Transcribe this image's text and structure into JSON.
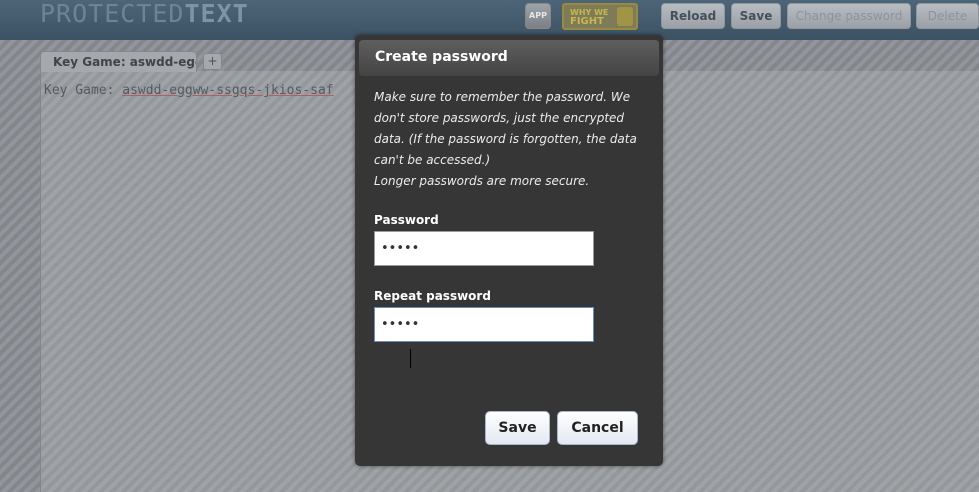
{
  "header": {
    "logo_light": "PROTECTED",
    "logo_bold": "TEXT",
    "app_label": "APP",
    "fight_line1": "WHY WE",
    "fight_line2": "FIGHT",
    "buttons": {
      "reload": "Reload",
      "save": "Save",
      "change_password": "Change password",
      "delete": "Delete"
    }
  },
  "tabs": [
    {
      "label": "Key Game: aswdd-egg..."
    }
  ],
  "add_tab_label": "+",
  "editor": {
    "prefix": "Key Game: ",
    "value": "aswdd-eggww-ssgqs-jkios-saf"
  },
  "dialog": {
    "title": "Create password",
    "notice_line1": "Make sure to remember the password. We don't store passwords, just the encrypted data. (If the password is forgotten, the data can't be accessed.)",
    "notice_line2": "Longer passwords are more secure.",
    "password_label": "Password",
    "password_value": "•••••",
    "repeat_label": "Repeat password",
    "repeat_value": "•••••",
    "save_label": "Save",
    "cancel_label": "Cancel"
  },
  "colors": {
    "topbar": "#465d70",
    "dialog_bg": "#363636",
    "button_border": "#a7b7c9"
  }
}
